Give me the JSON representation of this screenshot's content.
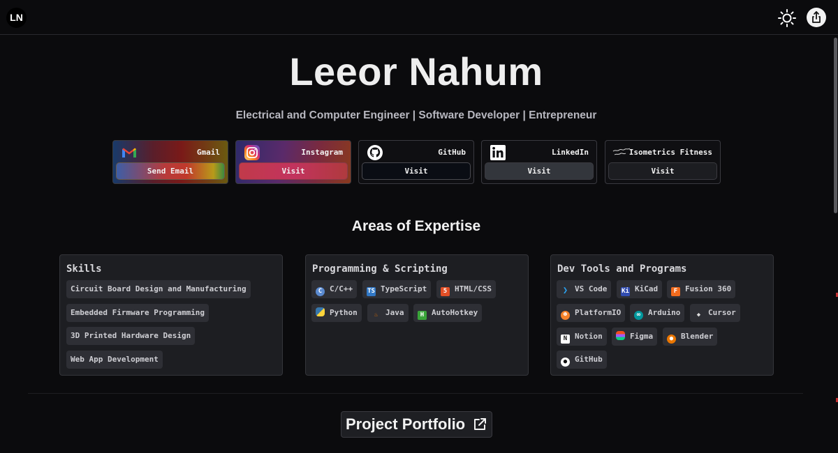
{
  "header": {
    "logo": "LN",
    "theme_toggle_icon": "sun-icon",
    "share_icon": "share-icon"
  },
  "hero": {
    "name": "Leeor Nahum",
    "subtitle": "Electrical and Computer Engineer | Software Developer | Entrepreneur"
  },
  "links": [
    {
      "label": "Gmail",
      "button": "Send Email",
      "icon": "gmail-icon"
    },
    {
      "label": "Instagram",
      "button": "Visit",
      "icon": "instagram-icon"
    },
    {
      "label": "GitHub",
      "button": "Visit",
      "icon": "github-icon"
    },
    {
      "label": "LinkedIn",
      "button": "Visit",
      "icon": "linkedin-icon"
    },
    {
      "label": "Isometrics Fitness",
      "button": "Visit",
      "icon": "isometrics-fitness-logo"
    }
  ],
  "expertise": {
    "title": "Areas of Expertise",
    "skills": {
      "title": "Skills",
      "items": [
        "Circuit Board Design and Manufacturing",
        "Embedded Firmware Programming",
        "3D Printed Hardware Design",
        "Web App Development"
      ]
    },
    "programming": {
      "title": "Programming & Scripting",
      "items": [
        {
          "label": "C/C++",
          "icon": "c-cpp-icon"
        },
        {
          "label": "TypeScript",
          "icon": "typescript-icon"
        },
        {
          "label": "HTML/CSS",
          "icon": "html5-icon"
        },
        {
          "label": "Python",
          "icon": "python-icon"
        },
        {
          "label": "Java",
          "icon": "java-icon"
        },
        {
          "label": "AutoHotkey",
          "icon": "autohotkey-icon"
        }
      ]
    },
    "tools": {
      "title": "Dev Tools and Programs",
      "items": [
        {
          "label": "VS Code",
          "icon": "vscode-icon"
        },
        {
          "label": "KiCad",
          "icon": "kicad-icon"
        },
        {
          "label": "Fusion 360",
          "icon": "fusion360-icon"
        },
        {
          "label": "PlatformIO",
          "icon": "platformio-icon"
        },
        {
          "label": "Arduino",
          "icon": "arduino-icon"
        },
        {
          "label": "Cursor",
          "icon": "cursor-icon"
        },
        {
          "label": "Notion",
          "icon": "notion-icon"
        },
        {
          "label": "Figma",
          "icon": "figma-icon"
        },
        {
          "label": "Blender",
          "icon": "blender-icon"
        },
        {
          "label": "GitHub",
          "icon": "github-icon"
        }
      ]
    }
  },
  "portfolio": {
    "label": "Project Portfolio",
    "icon": "external-link-icon"
  },
  "colors": {
    "background": "#0b0b0d",
    "panel": "#1d1e22",
    "chip": "#2e2f35",
    "text": "#e8e8ea"
  }
}
